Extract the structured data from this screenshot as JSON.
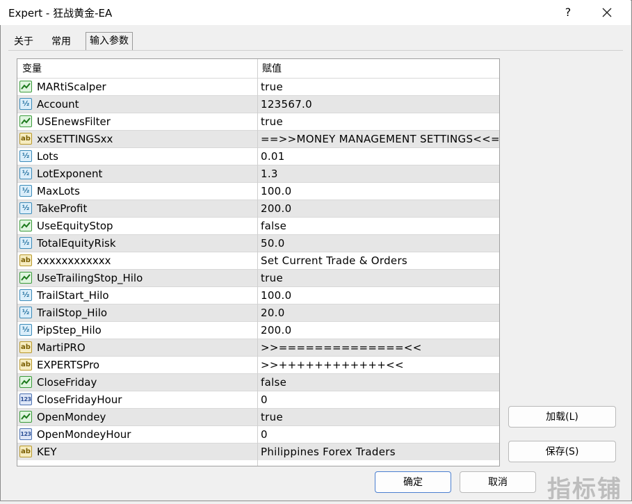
{
  "window": {
    "title": "Expert - 狂战黄金-EA",
    "help": "?",
    "close": "✕"
  },
  "tabs": [
    {
      "label": "关于"
    },
    {
      "label": "常用"
    },
    {
      "label": "输入参数"
    }
  ],
  "table": {
    "headers": {
      "variable": "变量",
      "value": "赋值"
    },
    "rows": [
      {
        "type": "bool",
        "icon": "bool-icon",
        "name": "MARtiScalper",
        "value": "true"
      },
      {
        "type": "double",
        "icon": "double-icon",
        "name": "Account",
        "value": "123567.0"
      },
      {
        "type": "bool",
        "icon": "bool-icon",
        "name": "USEnewsFilter",
        "value": "true"
      },
      {
        "type": "string",
        "icon": "string-icon",
        "name": "xxSETTINGSxx",
        "value": "==>>MONEY MANAGEMENT SETTINGS<<=="
      },
      {
        "type": "double",
        "icon": "double-icon",
        "name": "Lots",
        "value": "0.01"
      },
      {
        "type": "double",
        "icon": "double-icon",
        "name": "LotExponent",
        "value": "1.3"
      },
      {
        "type": "double",
        "icon": "double-icon",
        "name": "MaxLots",
        "value": "100.0"
      },
      {
        "type": "double",
        "icon": "double-icon",
        "name": "TakeProfit",
        "value": "200.0"
      },
      {
        "type": "bool",
        "icon": "bool-icon",
        "name": "UseEquityStop",
        "value": "false"
      },
      {
        "type": "double",
        "icon": "double-icon",
        "name": "TotalEquityRisk",
        "value": "50.0"
      },
      {
        "type": "string",
        "icon": "string-icon",
        "name": "xxxxxxxxxxxx",
        "value": "Set Current Trade & Orders"
      },
      {
        "type": "bool",
        "icon": "bool-icon",
        "name": "UseTrailingStop_Hilo",
        "value": "true"
      },
      {
        "type": "double",
        "icon": "double-icon",
        "name": "TrailStart_Hilo",
        "value": "100.0"
      },
      {
        "type": "double",
        "icon": "double-icon",
        "name": "TrailStop_Hilo",
        "value": "20.0"
      },
      {
        "type": "double",
        "icon": "double-icon",
        "name": "PipStep_Hilo",
        "value": "200.0"
      },
      {
        "type": "string",
        "icon": "string-icon",
        "name": "MartiPRO",
        "value": ">>==============<<"
      },
      {
        "type": "string",
        "icon": "string-icon",
        "name": "EXPERTSPro",
        "value": ">>++++++++++++<<"
      },
      {
        "type": "bool",
        "icon": "bool-icon",
        "name": "CloseFriday",
        "value": "false"
      },
      {
        "type": "int",
        "icon": "int-icon",
        "name": "CloseFridayHour",
        "value": "0"
      },
      {
        "type": "bool",
        "icon": "bool-icon",
        "name": "OpenMondey",
        "value": "true"
      },
      {
        "type": "int",
        "icon": "int-icon",
        "name": "OpenMondeyHour",
        "value": "0"
      },
      {
        "type": "string",
        "icon": "string-icon",
        "name": "KEY",
        "value": "Philippines Forex Traders"
      }
    ]
  },
  "icon_glyphs": {
    "double": "½",
    "string": "ab",
    "int": "123"
  },
  "buttons": {
    "load": "加载(L)",
    "save": "保存(S)",
    "ok": "确定",
    "cancel": "取消"
  },
  "watermark": "指标铺",
  "colors": {
    "row_alt": "#e6e6e6",
    "bool_icon": "#3a9a3a",
    "double_icon": "#3a8ab8",
    "string_icon": "#b8982a",
    "int_icon": "#4a6fb0",
    "primary_border": "#4a7fd0"
  }
}
